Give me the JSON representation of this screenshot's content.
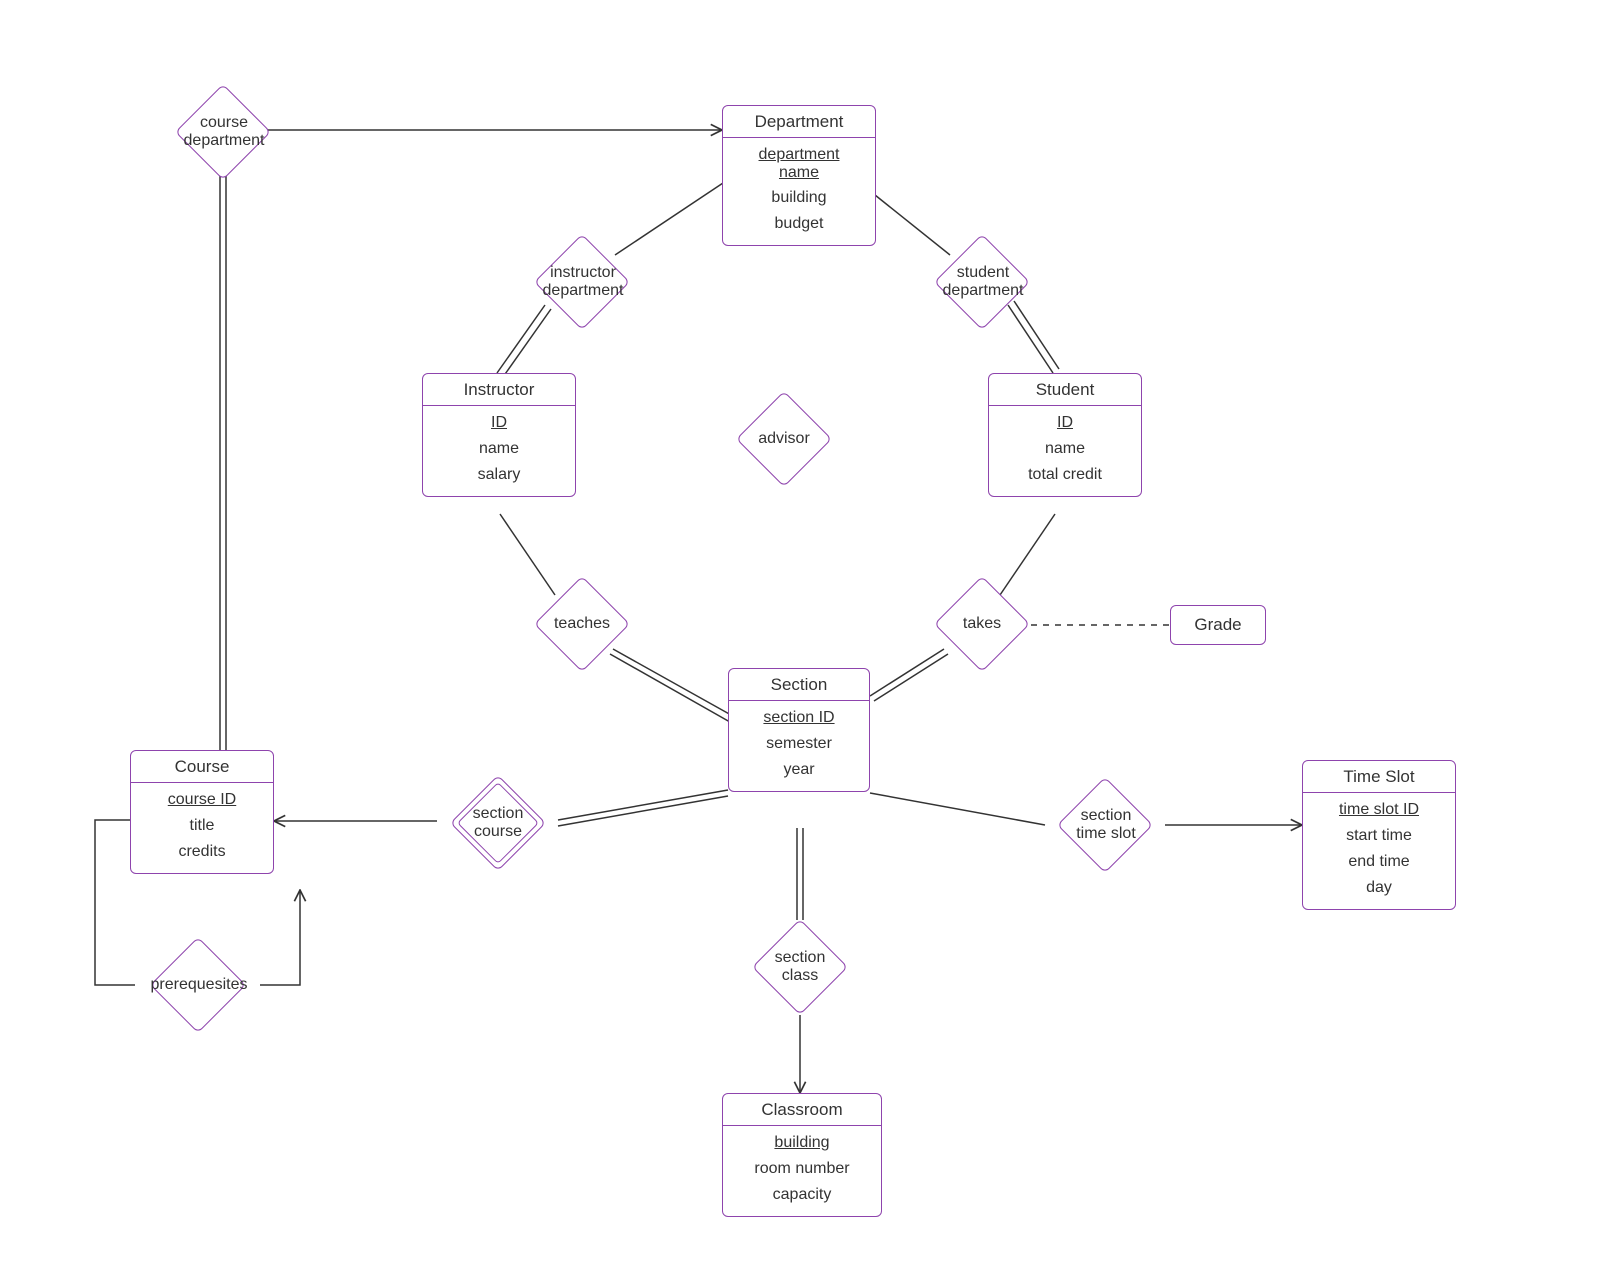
{
  "entities": {
    "department": {
      "title": "Department",
      "attrs": [
        "department name",
        "building",
        "budget"
      ],
      "pk": 0,
      "pk_multiline": true
    },
    "instructor": {
      "title": "Instructor",
      "attrs": [
        "ID",
        "name",
        "salary"
      ],
      "pk": 0
    },
    "student": {
      "title": "Student",
      "attrs": [
        "ID",
        "name",
        "total credit"
      ],
      "pk": 0
    },
    "section": {
      "title": "Section",
      "attrs": [
        "section ID",
        "semester",
        "year"
      ],
      "pk": 0
    },
    "course": {
      "title": "Course",
      "attrs": [
        "course ID",
        "title",
        "credits"
      ],
      "pk": 0
    },
    "timeslot": {
      "title": "Time Slot",
      "attrs": [
        "time slot ID",
        "start time",
        "end time",
        "day"
      ],
      "pk": 0
    },
    "classroom": {
      "title": "Classroom",
      "attrs": [
        "building",
        "room number",
        "capacity"
      ],
      "pk": 0
    }
  },
  "relationships": {
    "course_department": "course\ndepartment",
    "instructor_department": "instructor\ndepartment",
    "student_department": "student\ndepartment",
    "advisor": "advisor",
    "teaches": "teaches",
    "takes": "takes",
    "section_course": "section\ncourse",
    "section_timeslot": "section\ntime slot",
    "section_class": "section\nclass",
    "prerequisites": "prerequesites"
  },
  "labels": {
    "grade": "Grade"
  },
  "colors": {
    "border": "#8e44ad",
    "line": "#333333"
  }
}
